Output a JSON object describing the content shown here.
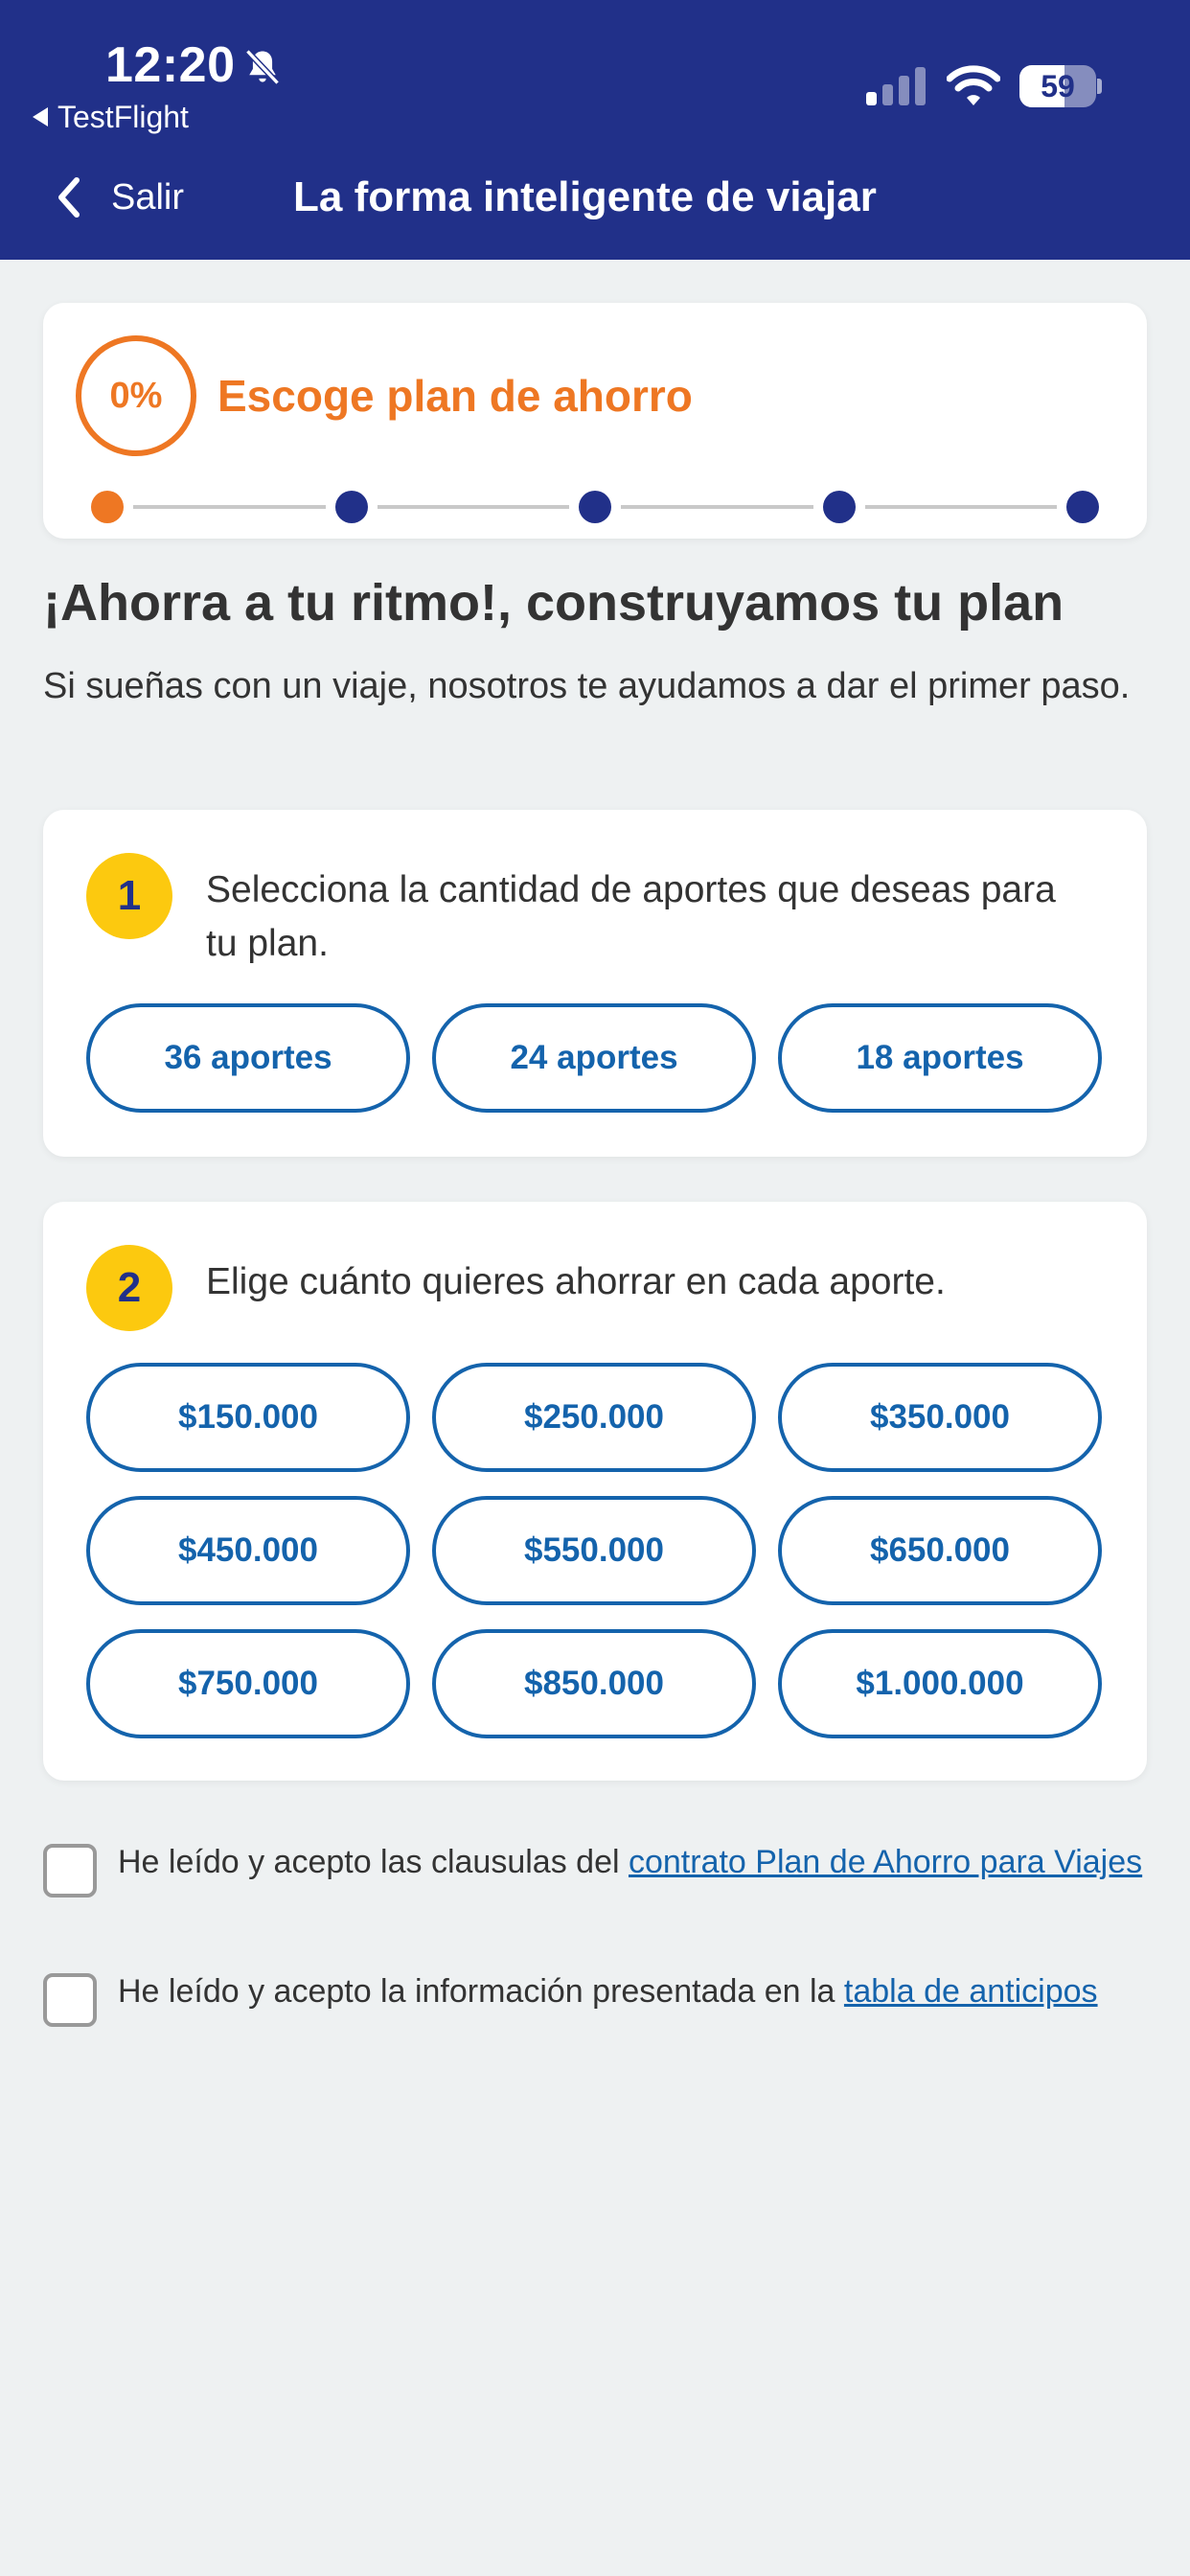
{
  "status_bar": {
    "time": "12:20",
    "back_app": "TestFlight",
    "battery": "59",
    "battery_level": 0.59,
    "icons": [
      "bell-slash-icon",
      "cellular-signal-icon",
      "wifi-icon",
      "battery-icon"
    ]
  },
  "nav": {
    "back_label": "Salir",
    "title": "La forma inteligente de viajar",
    "icons": [
      "chevron-left-icon"
    ]
  },
  "progress": {
    "percent": "0%",
    "step_title": "Escoge plan de ahorro",
    "total_steps": 5,
    "current_step": 1
  },
  "intro": {
    "heading": "¡Ahorra a tu ritmo!, construyamos tu plan",
    "subtitle": "Si sueñas con un viaje, nosotros te ayudamos a dar el primer paso."
  },
  "step1": {
    "number": "1",
    "text": "Selecciona la cantidad de aportes que deseas para tu plan.",
    "options": [
      "36 aportes",
      "24 aportes",
      "18 aportes"
    ]
  },
  "step2": {
    "number": "2",
    "text": "Elige cuánto quieres ahorrar en cada aporte.",
    "options": [
      "$150.000",
      "$250.000",
      "$350.000",
      "$450.000",
      "$550.000",
      "$650.000",
      "$750.000",
      "$850.000",
      "$1.000.000"
    ]
  },
  "terms": {
    "contract_text": "He leído y acepto las clausulas del ",
    "contract_link": "contrato Plan de Ahorro para Viajes",
    "table_text": "He leído y acepto la información presentada en la ",
    "table_link": "tabla de anticipos"
  },
  "colors": {
    "header_bg": "#213089",
    "accent_orange": "#ee7723",
    "link_blue": "#1463ac",
    "badge_yellow": "#fcc90f",
    "page_bg": "#eef1f2"
  }
}
